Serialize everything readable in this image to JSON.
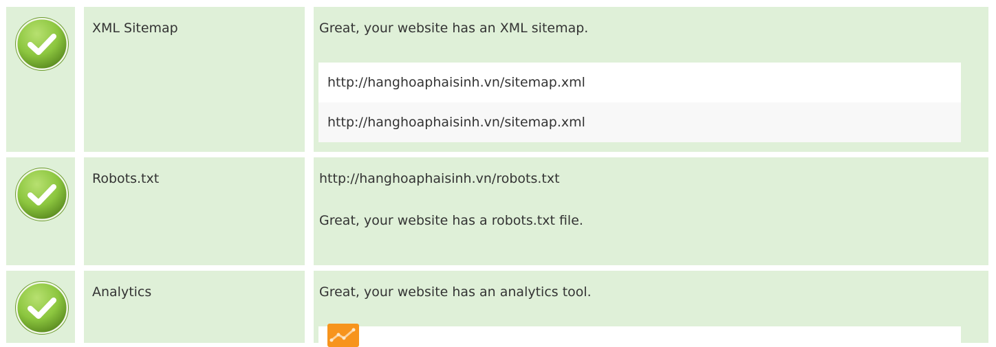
{
  "rows": [
    {
      "status": "pass",
      "name": "XML Sitemap",
      "message": "Great, your website has an XML sitemap.",
      "sitemaps": [
        "http://hanghoaphaisinh.vn/sitemap.xml",
        "http://hanghoaphaisinh.vn/sitemap.xml"
      ]
    },
    {
      "status": "pass",
      "name": "Robots.txt",
      "url": "http://hanghoaphaisinh.vn/robots.txt",
      "message": "Great, your website has a robots.txt file."
    },
    {
      "status": "pass",
      "name": "Analytics",
      "message": "Great, your website has an analytics tool.",
      "tools": [
        {
          "icon": "google-analytics-icon"
        }
      ]
    }
  ],
  "colors": {
    "row_background": "#dff0d8",
    "check_fill": "#8cc63f",
    "check_border": "#6a9a2a",
    "analytics_orange": "#f7941d"
  }
}
